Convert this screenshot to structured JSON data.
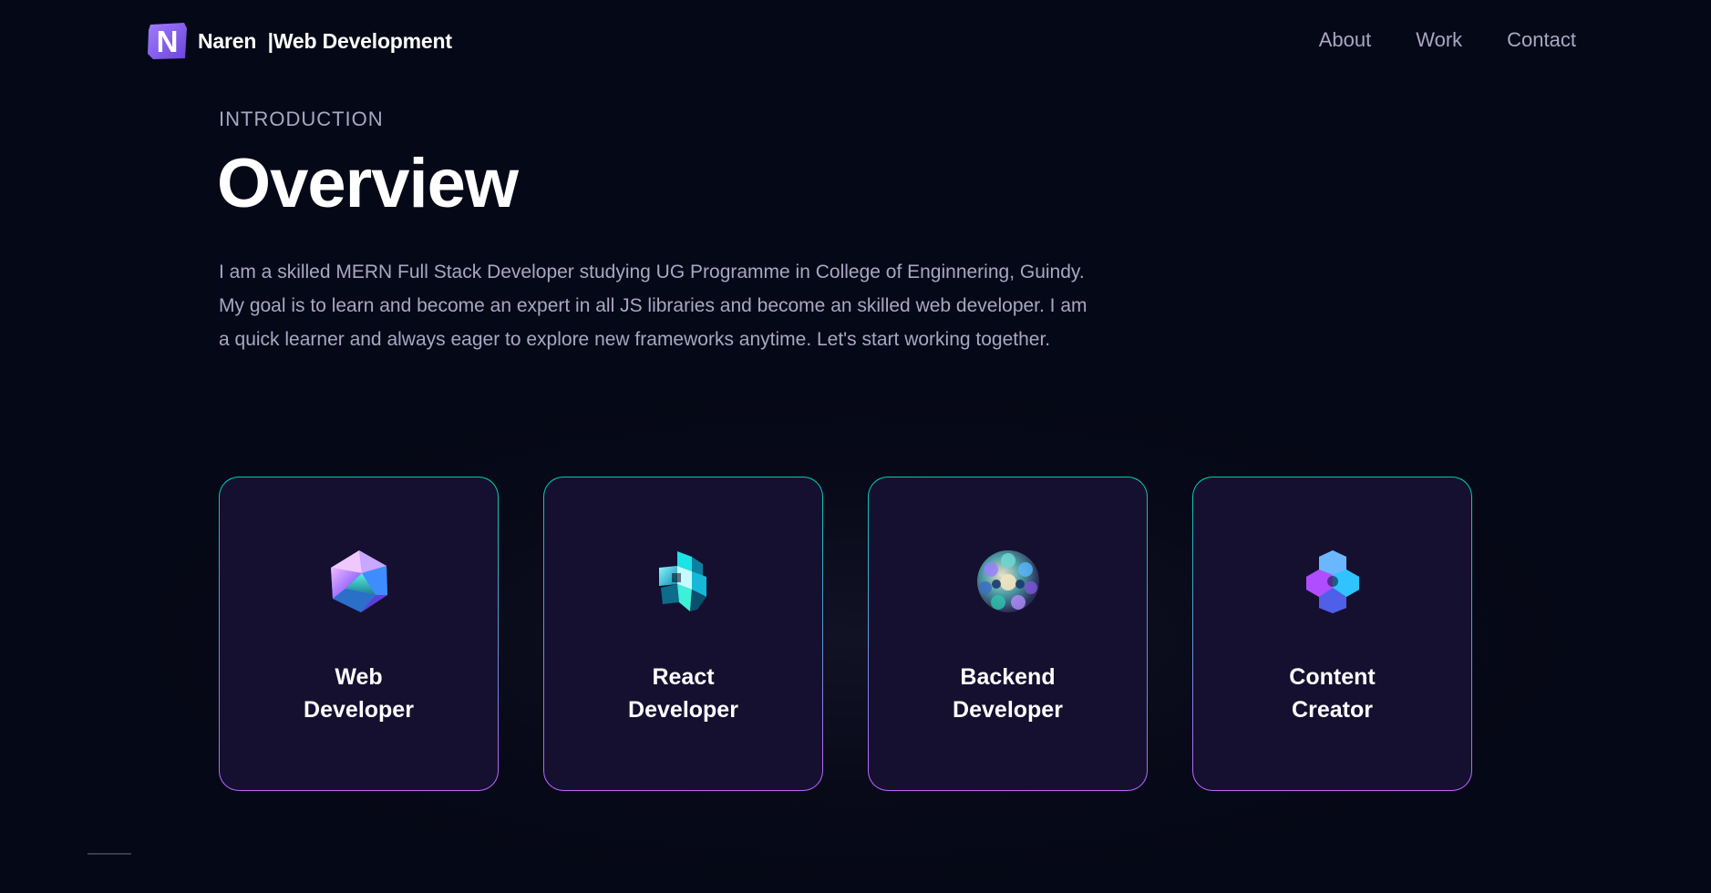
{
  "navbar": {
    "logo_letter": "N",
    "brand": "Naren",
    "brand_separator": "|",
    "brand_tagline": "Web Development",
    "links": [
      {
        "label": "About"
      },
      {
        "label": "Work"
      },
      {
        "label": "Contact"
      }
    ]
  },
  "intro": {
    "subtitle": "Introduction",
    "heading": "Overview",
    "paragraph": "I am a skilled MERN Full Stack Developer studying UG Programme in College of Enginnering, Guindy. My goal is to learn and become an expert in all JS libraries and become an skilled web developer. I am a quick learner and always eager to explore new frameworks anytime. Let's start working together."
  },
  "services": [
    {
      "line1": "Web",
      "line2": "Developer",
      "icon": "icosahedron-icon"
    },
    {
      "line1": "React",
      "line2": "Developer",
      "icon": "cube-knot-icon"
    },
    {
      "line1": "Backend",
      "line2": "Developer",
      "icon": "sphere-cluster-icon"
    },
    {
      "line1": "Content",
      "line2": "Creator",
      "icon": "hex-star-icon"
    }
  ],
  "colors": {
    "background": "#050816",
    "card": "#151030",
    "secondary_text": "#aaa6c3",
    "border_top": "#00cea8",
    "border_bottom": "#bf61ff",
    "logo": "#915eff"
  }
}
